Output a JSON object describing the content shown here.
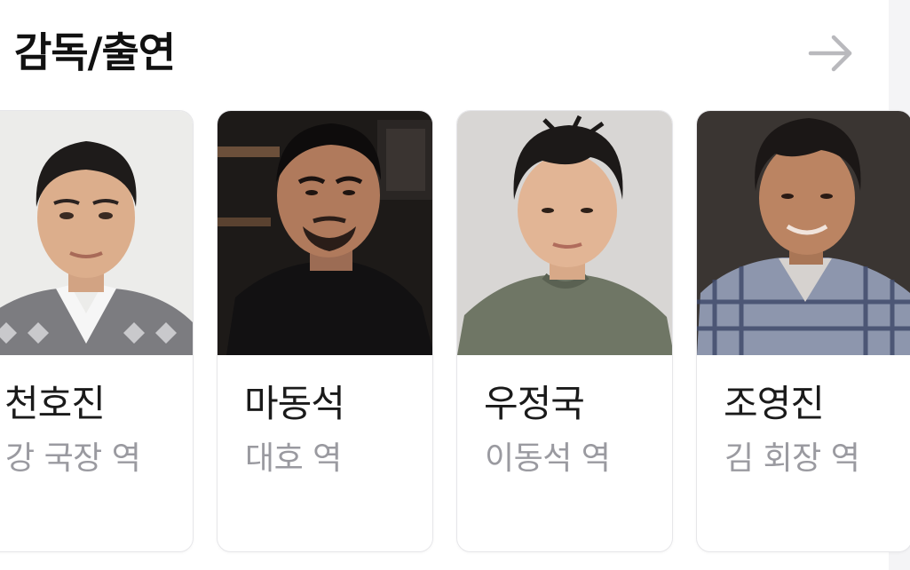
{
  "section": {
    "title": "감독/출연",
    "more_icon": "arrow-right-icon"
  },
  "cast": [
    {
      "name": "천호진",
      "role": "강 국장 역"
    },
    {
      "name": "마동석",
      "role": "대호 역"
    },
    {
      "name": "우정국",
      "role": "이동석 역"
    },
    {
      "name": "조영진",
      "role": "김 회장 역"
    }
  ],
  "colors": {
    "title": "#111111",
    "name": "#1a1a1a",
    "role": "#9a9aa0",
    "arrow": "#b9b9bd",
    "card_border": "#e6e6e9"
  }
}
